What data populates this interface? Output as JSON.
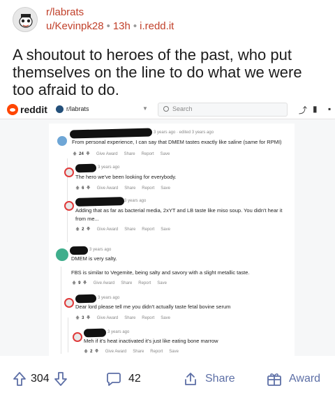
{
  "post": {
    "subreddit": "r/labrats",
    "author": "u/Kevinpk28",
    "age": "13h",
    "domain": "i.redd.it",
    "title": "A shoutout to heroes of the past, who put themselves on the line to do what we were too afraid to do."
  },
  "screenshot": {
    "logo_text": "reddit",
    "subreddit": "r/labrats",
    "search_placeholder": "Search",
    "comments": [
      {
        "time": "3 years ago · edited 3 years ago",
        "body": "From personal experience, I can say that DMEM tastes exactly like saline (same for RPMI)",
        "score": "24",
        "actions": [
          "Give Award",
          "Share",
          "Report",
          "Save"
        ]
      },
      {
        "time": "3 years ago",
        "body": "The hero we've been looking for everybody.",
        "score": "6",
        "actions": [
          "Give Award",
          "Share",
          "Report",
          "Save"
        ]
      },
      {
        "time": "3 years ago",
        "body": "Adding that as far as bacterial media, 2xYT and LB taste like miso soup. You didn't hear it from me...",
        "score": "2",
        "actions": [
          "Give Award",
          "Share",
          "Report",
          "Save"
        ]
      },
      {
        "time": "3 years ago",
        "body": "DMEM is very salty.",
        "body2": "FBS is similar to Vegemite, being salty and savory with a slight metallic taste.",
        "score": "9",
        "actions": [
          "Give Award",
          "Share",
          "Report",
          "Save"
        ]
      },
      {
        "time": "3 years ago",
        "body": "Dear lord please tell me you didn't actually taste fetal bovine serum",
        "score": "3",
        "actions": [
          "Give Award",
          "Share",
          "Report",
          "Save"
        ]
      },
      {
        "time": "3 years ago",
        "body": "Meh if it's heat inactivated it's just like eating bone marrow",
        "score": "2",
        "actions": [
          "Give Award",
          "Share",
          "Report",
          "Save"
        ]
      }
    ]
  },
  "actions": {
    "score": "304",
    "comments": "42",
    "share": "Share",
    "award": "Award"
  },
  "colors": {
    "accent_link": "#c1412b",
    "action_icon": "#5d6fa6",
    "reddit_orange": "#ff4500"
  }
}
